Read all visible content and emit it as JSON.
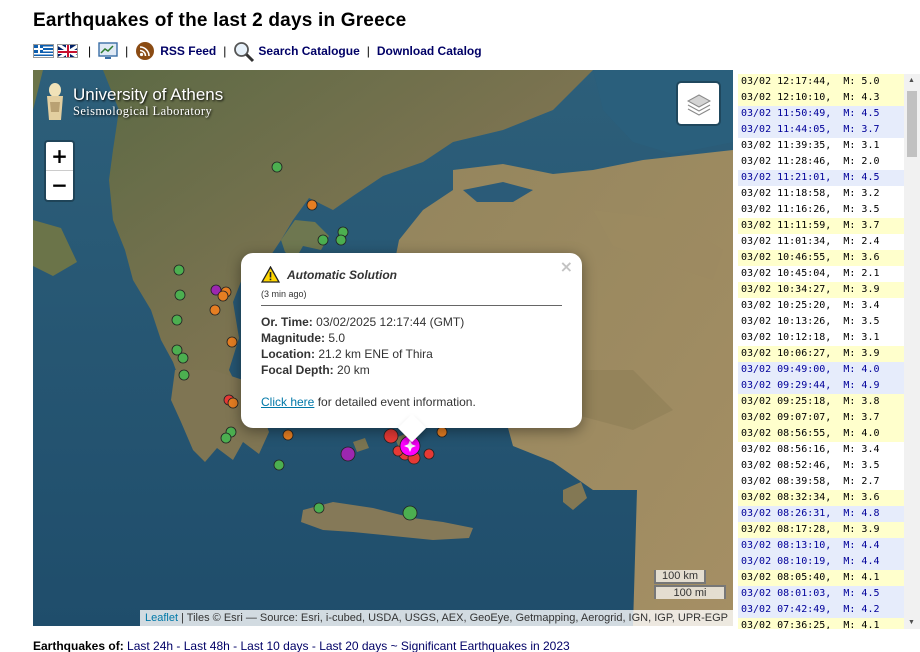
{
  "page": {
    "title": "Earthquakes of the last 2 days in Greece"
  },
  "toolbar": {
    "separator": "|",
    "rss_label": "RSS Feed",
    "search_label": "Search Catalogue",
    "download_label": "Download Catalog"
  },
  "map": {
    "logo_title": "University of Athens",
    "logo_subtitle": "Seismological Laboratory",
    "zoom_in": "+",
    "zoom_out": "−",
    "scale_km": "100 km",
    "scale_mi": "100 mi",
    "attribution_leaflet": "Leaflet",
    "attribution_text": " | Tiles © Esri — Source: Esri, i-cubed, USDA, USGS, AEX, GeoEye, Getmapping, Aerogrid, IGN, IGP, UPR-EGP",
    "marker_colors": {
      "recent": "#ff00ff",
      "hours": "#e53935",
      "day": "#e67e22",
      "older": "#4caf50",
      "purple": "#9c27b0"
    }
  },
  "popup": {
    "close": "×",
    "title": "Automatic Solution",
    "ago": "(3 min ago)",
    "origin_time_label": "Or. Time:",
    "origin_time_value": "03/02/2025 12:17:44 (GMT)",
    "magnitude_label": "Magnitude:",
    "magnitude_value": "5.0",
    "location_label": "Location:",
    "location_value": "21.2 km ENE of Thira",
    "depth_label": "Focal Depth:",
    "depth_value": "20 km",
    "click_here": "Click here",
    "more_info": " for detailed event information."
  },
  "events": [
    {
      "time": "03/02 12:17:44,",
      "mag": "M: 5.0",
      "style": "y"
    },
    {
      "time": "03/02 12:10:10,",
      "mag": "M: 4.3",
      "style": "y"
    },
    {
      "time": "03/02 11:50:49,",
      "mag": "M: 4.5",
      "style": "b"
    },
    {
      "time": "03/02 11:44:05,",
      "mag": "M: 3.7",
      "style": "b"
    },
    {
      "time": "03/02 11:39:35,",
      "mag": "M: 3.1",
      "style": "w"
    },
    {
      "time": "03/02 11:28:46,",
      "mag": "M: 2.0",
      "style": "w"
    },
    {
      "time": "03/02 11:21:01,",
      "mag": "M: 4.5",
      "style": "b"
    },
    {
      "time": "03/02 11:18:58,",
      "mag": "M: 3.2",
      "style": "w"
    },
    {
      "time": "03/02 11:16:26,",
      "mag": "M: 3.5",
      "style": "w"
    },
    {
      "time": "03/02 11:11:59,",
      "mag": "M: 3.7",
      "style": "y"
    },
    {
      "time": "03/02 11:01:34,",
      "mag": "M: 2.4",
      "style": "w"
    },
    {
      "time": "03/02 10:46:55,",
      "mag": "M: 3.6",
      "style": "y"
    },
    {
      "time": "03/02 10:45:04,",
      "mag": "M: 2.1",
      "style": "w"
    },
    {
      "time": "03/02 10:34:27,",
      "mag": "M: 3.9",
      "style": "y"
    },
    {
      "time": "03/02 10:25:20,",
      "mag": "M: 3.4",
      "style": "w"
    },
    {
      "time": "03/02 10:13:26,",
      "mag": "M: 3.5",
      "style": "w"
    },
    {
      "time": "03/02 10:12:18,",
      "mag": "M: 3.1",
      "style": "w"
    },
    {
      "time": "03/02 10:06:27,",
      "mag": "M: 3.9",
      "style": "y"
    },
    {
      "time": "03/02 09:49:00,",
      "mag": "M: 4.0",
      "style": "b"
    },
    {
      "time": "03/02 09:29:44,",
      "mag": "M: 4.9",
      "style": "b"
    },
    {
      "time": "03/02 09:25:18,",
      "mag": "M: 3.8",
      "style": "y"
    },
    {
      "time": "03/02 09:07:07,",
      "mag": "M: 3.7",
      "style": "y"
    },
    {
      "time": "03/02 08:56:55,",
      "mag": "M: 4.0",
      "style": "y"
    },
    {
      "time": "03/02 08:56:16,",
      "mag": "M: 3.4",
      "style": "w"
    },
    {
      "time": "03/02 08:52:46,",
      "mag": "M: 3.5",
      "style": "w"
    },
    {
      "time": "03/02 08:39:58,",
      "mag": "M: 2.7",
      "style": "w"
    },
    {
      "time": "03/02 08:32:34,",
      "mag": "M: 3.6",
      "style": "y"
    },
    {
      "time": "03/02 08:26:31,",
      "mag": "M: 4.8",
      "style": "b"
    },
    {
      "time": "03/02 08:17:28,",
      "mag": "M: 3.9",
      "style": "y"
    },
    {
      "time": "03/02 08:13:10,",
      "mag": "M: 4.4",
      "style": "b"
    },
    {
      "time": "03/02 08:10:19,",
      "mag": "M: 4.4",
      "style": "b"
    },
    {
      "time": "03/02 08:05:40,",
      "mag": "M: 4.1",
      "style": "y"
    },
    {
      "time": "03/02 08:01:03,",
      "mag": "M: 4.5",
      "style": "b"
    },
    {
      "time": "03/02 07:42:49,",
      "mag": "M: 4.2",
      "style": "b"
    },
    {
      "time": "03/02 07:36:25,",
      "mag": "M: 4.1",
      "style": "y"
    }
  ],
  "footer": {
    "label": "Earthquakes of: ",
    "last24": "Last 24h",
    "last48": "Last 48h",
    "last10": "Last 10 days",
    "last20": "Last 20 days",
    "significant": "Significant Earthquakes in 2023",
    "dash": " - ",
    "tilde": " ~ "
  }
}
